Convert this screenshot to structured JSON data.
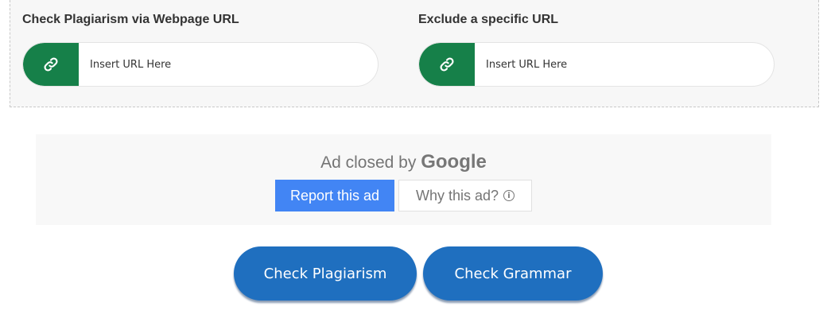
{
  "url_panel": {
    "check_url": {
      "heading": "Check Plagiarism via Webpage URL",
      "placeholder": "Insert URL Here",
      "icon": "link-icon"
    },
    "exclude_url": {
      "heading": "Exclude a specific URL",
      "placeholder": "Insert URL Here",
      "icon": "link-icon"
    }
  },
  "ad": {
    "closed_text": "Ad closed by",
    "brand": "Google",
    "report_label": "Report this ad",
    "why_label": "Why this ad?",
    "why_icon": "info-icon"
  },
  "actions": {
    "check_plagiarism": "Check Plagiarism",
    "check_grammar": "Check Grammar"
  },
  "colors": {
    "link_icon_bg": "#168049",
    "report_button_bg": "#4285f4",
    "action_button_bg": "#1f6fbf"
  }
}
